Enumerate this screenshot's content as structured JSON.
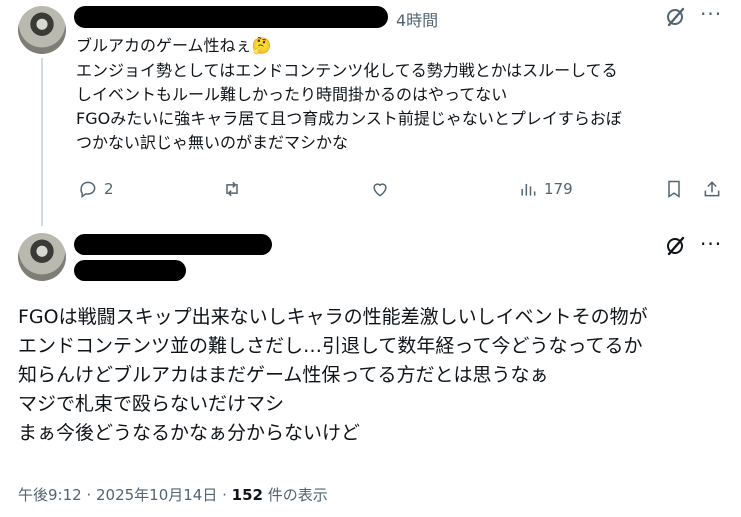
{
  "reply": {
    "time": "4時間",
    "text_line1": "ブルアカのゲーム性ねぇ🤔",
    "text_rest": "エンジョイ勢としてはエンドコンテンツ化してる勢力戦とかはスルーしてる\nしイベントもルール難しかったり時間掛かるのはやってない\nFGOみたいに強キャラ居て且つ育成カンスト前提じゃないとプレイすらおぼ\nつかない訳じゃ無いのがまだマシかな",
    "reply_count": "2",
    "view_count": "179"
  },
  "main_post": {
    "text": "FGOは戦闘スキップ出来ないしキャラの性能差激しいしイベントその物が\nエンドコンテンツ並の難しさだし…引退して数年経って今どうなってるか\n知らんけどブルアカはまだゲーム性保ってる方だとは思うなぁ\nマジで札束で殴らないだけマシ\nまぁ今後どうなるかなぁ分からないけど",
    "timestamp": "午後9:12 · 2025年10月14日 · ",
    "views_number": "152",
    "views_suffix": " 件の表示"
  },
  "icons": {
    "grok": "grok-slash-icon",
    "more": "more-dots-icon",
    "reply": "reply-bubble-icon",
    "retweet": "retweet-arrows-icon",
    "like": "heart-icon",
    "views": "bar-chart-icon",
    "bookmark": "bookmark-icon",
    "share": "share-arrow-icon"
  },
  "more_glyph": "···"
}
